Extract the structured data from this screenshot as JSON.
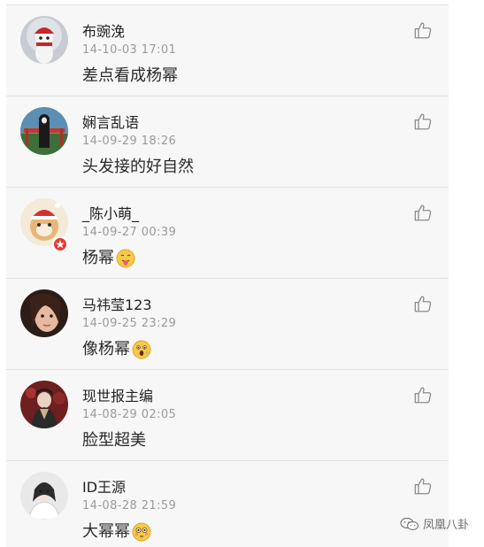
{
  "comments": [
    {
      "username": "布豌浼",
      "timestamp": "14-10-03 17:01",
      "text": "差点看成杨幂",
      "emoji": ""
    },
    {
      "username": "娴言乱语",
      "timestamp": "14-09-29 18:26",
      "text": "头发接的好自然",
      "emoji": ""
    },
    {
      "username": "_陈小萌_",
      "timestamp": "14-09-27 00:39",
      "text": "杨幂",
      "emoji": "tongue-emoji"
    },
    {
      "username": "马祎莹123",
      "timestamp": "14-09-25 23:29",
      "text": "像杨幂",
      "emoji": "shocked-emoji"
    },
    {
      "username": "现世报主编",
      "timestamp": "14-08-29 02:05",
      "text": "脸型超美",
      "emoji": ""
    },
    {
      "username": "ID王源",
      "timestamp": "14-08-28 21:59",
      "text": "大幂幂",
      "emoji": "flushed-emoji"
    }
  ],
  "watermark": {
    "text": "凤凰八卦",
    "icon": "wechat-icon"
  },
  "colors": {
    "feed_background": "#f7f7f7",
    "divider": "#e2e2e2",
    "timestamp": "#9a9a9a",
    "badge": "#e8392f",
    "like_icon": "#8a8a8a"
  }
}
